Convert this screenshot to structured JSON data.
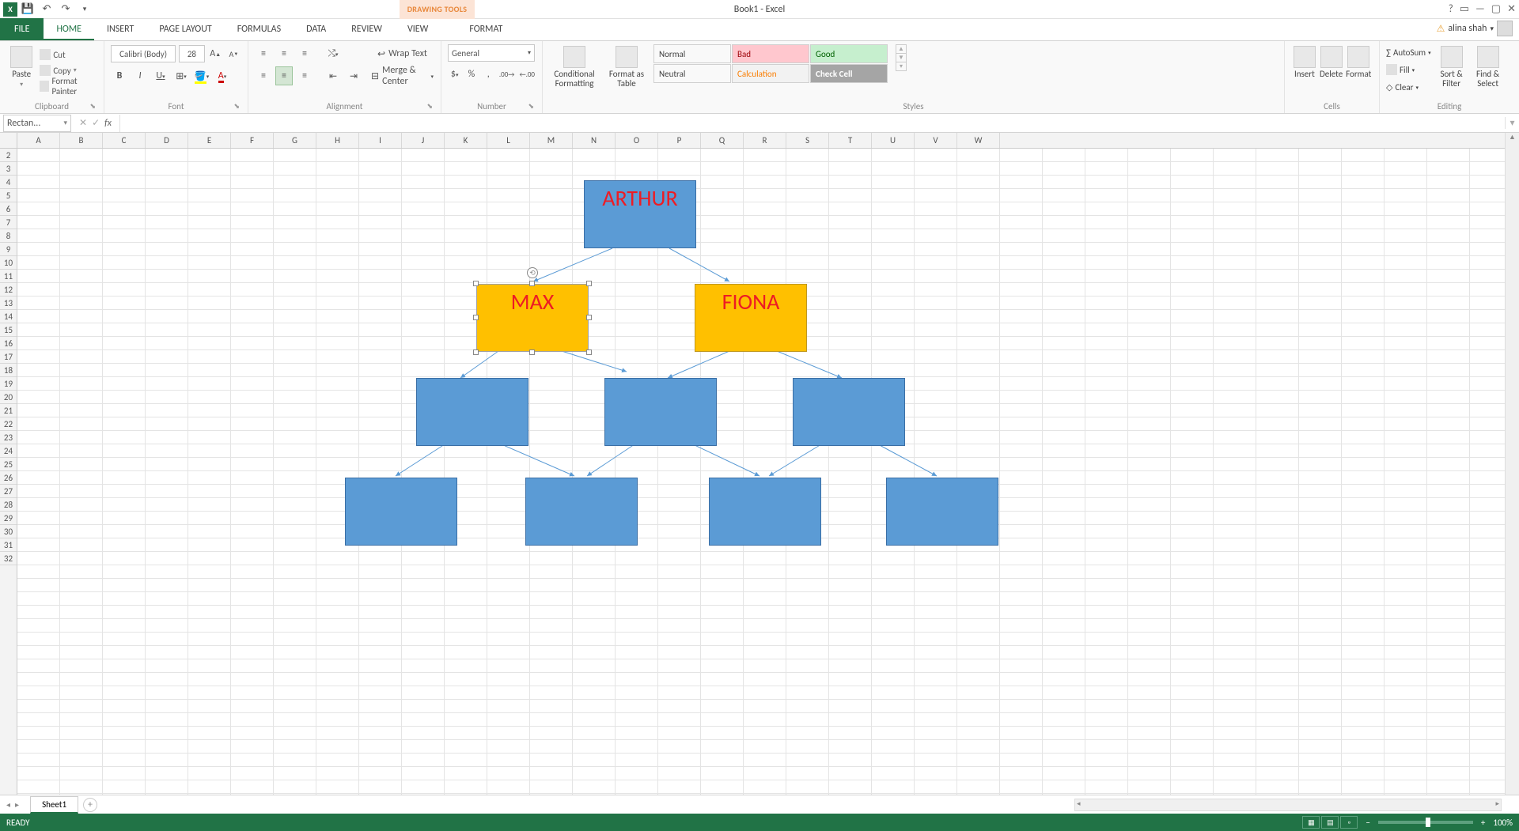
{
  "title_bar": {
    "doc_title": "Book1 - Excel",
    "contextual": "DRAWING TOOLS"
  },
  "tabs": {
    "file": "FILE",
    "home": "HOME",
    "insert": "INSERT",
    "page_layout": "PAGE LAYOUT",
    "formulas": "FORMULAS",
    "data": "DATA",
    "review": "REVIEW",
    "view": "VIEW",
    "format": "FORMAT"
  },
  "account": {
    "user": "alina shah"
  },
  "ribbon": {
    "clipboard": {
      "label": "Clipboard",
      "paste": "Paste",
      "cut": "Cut",
      "copy": "Copy",
      "fp": "Format Painter"
    },
    "font": {
      "label": "Font",
      "name": "Calibri (Body)",
      "size": "28",
      "bold": "B",
      "italic": "I",
      "underline": "U"
    },
    "alignment": {
      "label": "Alignment",
      "wrap": "Wrap Text",
      "merge": "Merge & Center"
    },
    "number": {
      "label": "Number",
      "format": "General"
    },
    "styles": {
      "label": "Styles",
      "cond": "Conditional Formatting",
      "fat": "Format as Table",
      "normal": "Normal",
      "bad": "Bad",
      "good": "Good",
      "neutral": "Neutral",
      "calc": "Calculation",
      "check": "Check Cell"
    },
    "cells": {
      "label": "Cells",
      "insert": "Insert",
      "delete": "Delete",
      "format": "Format"
    },
    "editing": {
      "label": "Editing",
      "autosum": "AutoSum",
      "fill": "Fill",
      "clear": "Clear",
      "sort": "Sort & Filter",
      "find": "Find & Select"
    }
  },
  "name_box": "Rectan...",
  "columns": [
    "A",
    "B",
    "C",
    "D",
    "E",
    "F",
    "G",
    "H",
    "I",
    "J",
    "K",
    "L",
    "M",
    "N",
    "O",
    "P",
    "Q",
    "R",
    "S",
    "T",
    "U",
    "V",
    "W"
  ],
  "first_row": 2,
  "row_count": 31,
  "shapes": {
    "arthur": "ARTHUR",
    "max": "MAX",
    "fiona": "FIONA"
  },
  "sheet_tabs": {
    "sheet1": "Sheet1"
  },
  "status": {
    "ready": "READY",
    "zoom": "100%"
  }
}
